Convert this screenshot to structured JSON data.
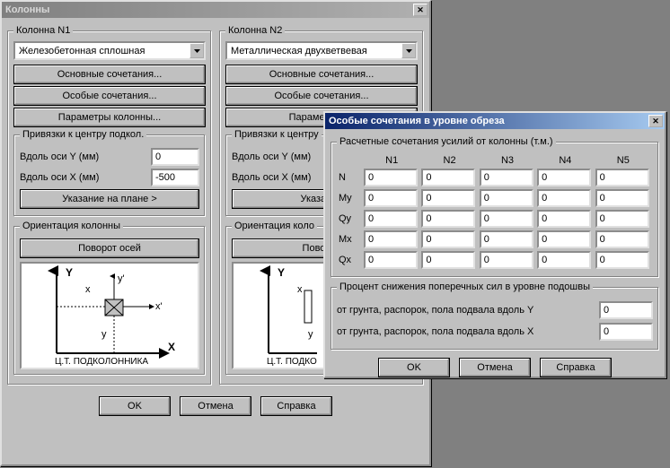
{
  "main_window": {
    "title": "Колонны",
    "columns": [
      {
        "legend": "Колонна N1",
        "type_selected": "Железобетонная сплошная",
        "btn_main_comb": "Основные сочетания...",
        "btn_special_comb": "Особые сочетания...",
        "btn_params": "Параметры колонны...",
        "bindings_legend": "Привязки к центру подкол.",
        "along_y_label": "Вдоль оси Y (мм)",
        "along_y_value": "0",
        "along_x_label": "Вдоль оси X (мм)",
        "along_x_value": "-500",
        "btn_plan": "Указание на плане >",
        "orientation_legend": "Ориентация колонны",
        "btn_rotate": "Поворот осей",
        "diag_y": "Y",
        "diag_x": "X",
        "diag_xp": "x'",
        "diag_yp": "y'",
        "diag_cross_x": "x",
        "diag_cross_y": "y",
        "diag_label": "Ц.Т.  ПОДКОЛОННИКА"
      },
      {
        "legend": "Колонна N2",
        "type_selected": "Металлическая двухветвевая",
        "btn_main_comb": "Основные сочетания...",
        "btn_special_comb": "Особые сочетания...",
        "btn_params": "Параметры ко",
        "bindings_legend": "Привязки к центру",
        "along_y_label": "Вдоль оси Y (мм)",
        "along_y_value": "",
        "along_x_label": "Вдоль оси X (мм)",
        "along_x_value": "",
        "btn_plan": "Указание",
        "orientation_legend": "Ориентация коло",
        "btn_rotate": "Поворот",
        "diag_y": "Y",
        "diag_x": "",
        "diag_xp": "",
        "diag_yp": "",
        "diag_cross_x": "x",
        "diag_cross_y": "y",
        "diag_label": "Ц.Т.  ПОДКО"
      }
    ],
    "ok": "OK",
    "cancel": "Отмена",
    "help": "Справка"
  },
  "modal": {
    "title": "Особые сочетания в уровне обреза",
    "forces_legend": "Расчетные сочетания усилий от колонны (т.м.)",
    "headers": [
      "N1",
      "N2",
      "N3",
      "N4",
      "N5"
    ],
    "rows": [
      {
        "label": "N",
        "values": [
          "0",
          "0",
          "0",
          "0",
          "0"
        ]
      },
      {
        "label": "My",
        "values": [
          "0",
          "0",
          "0",
          "0",
          "0"
        ]
      },
      {
        "label": "Qy",
        "values": [
          "0",
          "0",
          "0",
          "0",
          "0"
        ]
      },
      {
        "label": "Mx",
        "values": [
          "0",
          "0",
          "0",
          "0",
          "0"
        ]
      },
      {
        "label": "Qx",
        "values": [
          "0",
          "0",
          "0",
          "0",
          "0"
        ]
      }
    ],
    "pct_legend": "Процент снижения поперечных сил в уровне подошвы",
    "pct_y_label": "от грунта, распорок, пола подвала вдоль Y",
    "pct_y_value": "0",
    "pct_x_label": "от грунта, распорок, пола подвала вдоль X",
    "pct_x_value": "0",
    "ok": "OK",
    "cancel": "Отмена",
    "help": "Справка"
  }
}
